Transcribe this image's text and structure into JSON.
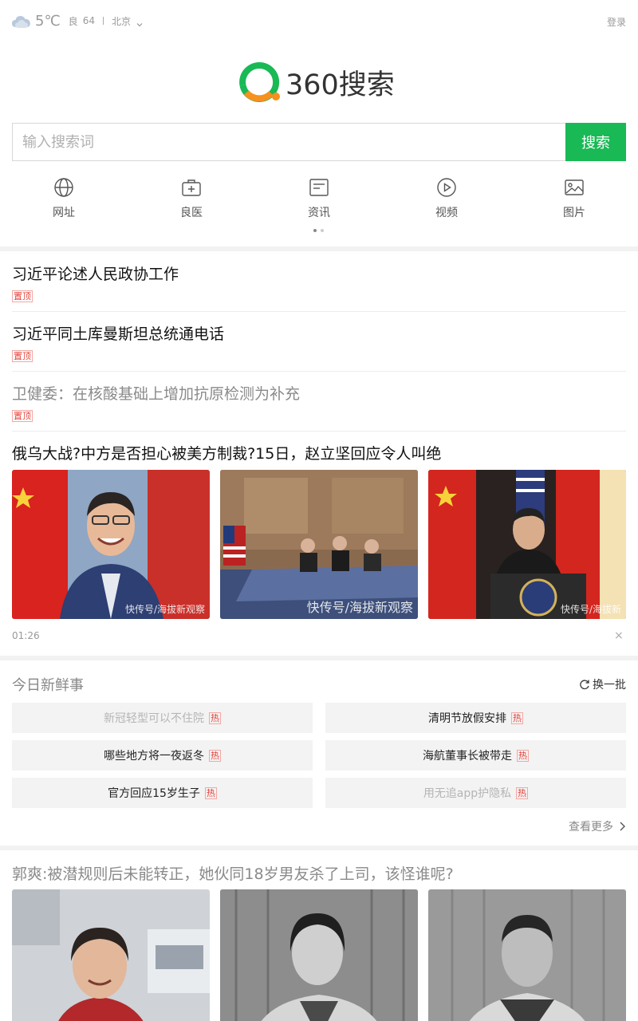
{
  "header": {
    "temperature": "5℃",
    "aqi_label": "良",
    "aqi_value": "64",
    "city": "北京",
    "login": "登录",
    "weather_icon": "cloud-icon"
  },
  "logo": {
    "text": "360搜索",
    "colors": {
      "green": "#19b955",
      "orange": "#f6901e"
    }
  },
  "search": {
    "placeholder": "输入搜索词",
    "button": "搜索",
    "accent": "#19b955"
  },
  "quicknav": [
    {
      "label": "网址",
      "icon": "globe-icon"
    },
    {
      "label": "良医",
      "icon": "medkit-icon"
    },
    {
      "label": "资讯",
      "icon": "news-icon"
    },
    {
      "label": "视频",
      "icon": "play-icon"
    },
    {
      "label": "图片",
      "icon": "image-icon"
    }
  ],
  "pinned": [
    {
      "title": "习近平论述人民政协工作",
      "tag": "置顶"
    },
    {
      "title": "习近平同土库曼斯坦总统通电话",
      "tag": "置顶"
    },
    {
      "title": "卫健委：在核酸基础上增加抗原检测为补充",
      "tag": "置顶"
    }
  ],
  "feature": {
    "title": "俄乌大战?中方是否担心被美方制裁?15日，赵立坚回应令人叫绝",
    "watermarks": [
      "快传号/海拔新观察",
      "快传号/海拔新观察",
      "快传号/海拔新"
    ],
    "time": "01:26",
    "close": "×"
  },
  "hot": {
    "title": "今日新鲜事",
    "refresh": "换一批",
    "badge": "热",
    "items": [
      {
        "text": "新冠轻型可以不住院"
      },
      {
        "text": "清明节放假安排"
      },
      {
        "text": "哪些地方将一夜返冬"
      },
      {
        "text": "海航董事长被带走"
      },
      {
        "text": "官方回应15岁生子"
      },
      {
        "text": "用无追app护隐私"
      }
    ],
    "more": "查看更多"
  },
  "news2": {
    "title": "郭爽:被潜规则后未能转正，她伙同18岁男友杀了上司，该怪谁呢?"
  }
}
